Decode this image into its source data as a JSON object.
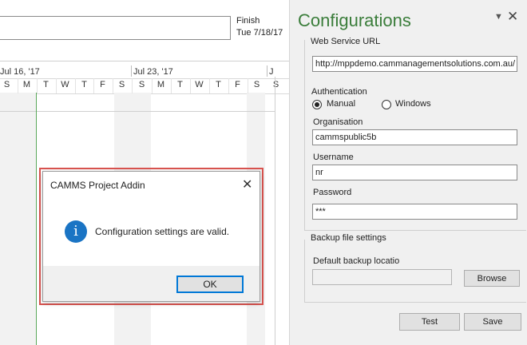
{
  "timeline": {
    "finish_label": "Finish",
    "finish_date": "Tue 7/18/17"
  },
  "gantt": {
    "week1": "Jul 16, '17",
    "week2": "Jul 23, '17",
    "week3": "J",
    "days": [
      "S",
      "M",
      "T",
      "W",
      "T",
      "F",
      "S",
      "S",
      "M",
      "T",
      "W",
      "T",
      "F",
      "S",
      "S"
    ]
  },
  "pane": {
    "title": "Configurations",
    "menu_icon": "caret-down-icon",
    "close_icon": "close-icon",
    "web_service_label": "Web Service URL",
    "web_service_url": "http://mppdemo.cammanagementsolutions.com.au/",
    "auth_label": "Authentication",
    "auth_manual": "Manual",
    "auth_windows": "Windows",
    "auth_selected": "Manual",
    "org_label": "Organisation",
    "org_value": "cammspublic5b",
    "username_label": "Username",
    "username_value": "nr",
    "password_label": "Password",
    "password_value": "***",
    "backup_group_label": "Backup file settings",
    "backup_location_label": "Default backup locatio",
    "backup_location_value": "",
    "browse_label": "Browse",
    "test_label": "Test",
    "save_label": "Save"
  },
  "dialog": {
    "title": "CAMMS Project Addin",
    "message": "Configuration settings are valid.",
    "ok_label": "OK",
    "icon": "info-icon",
    "highlight_color": "#d9534f"
  },
  "colors": {
    "accent_green": "#3a7d3a",
    "info_blue": "#1a74c4",
    "focus_blue": "#0078d7"
  }
}
